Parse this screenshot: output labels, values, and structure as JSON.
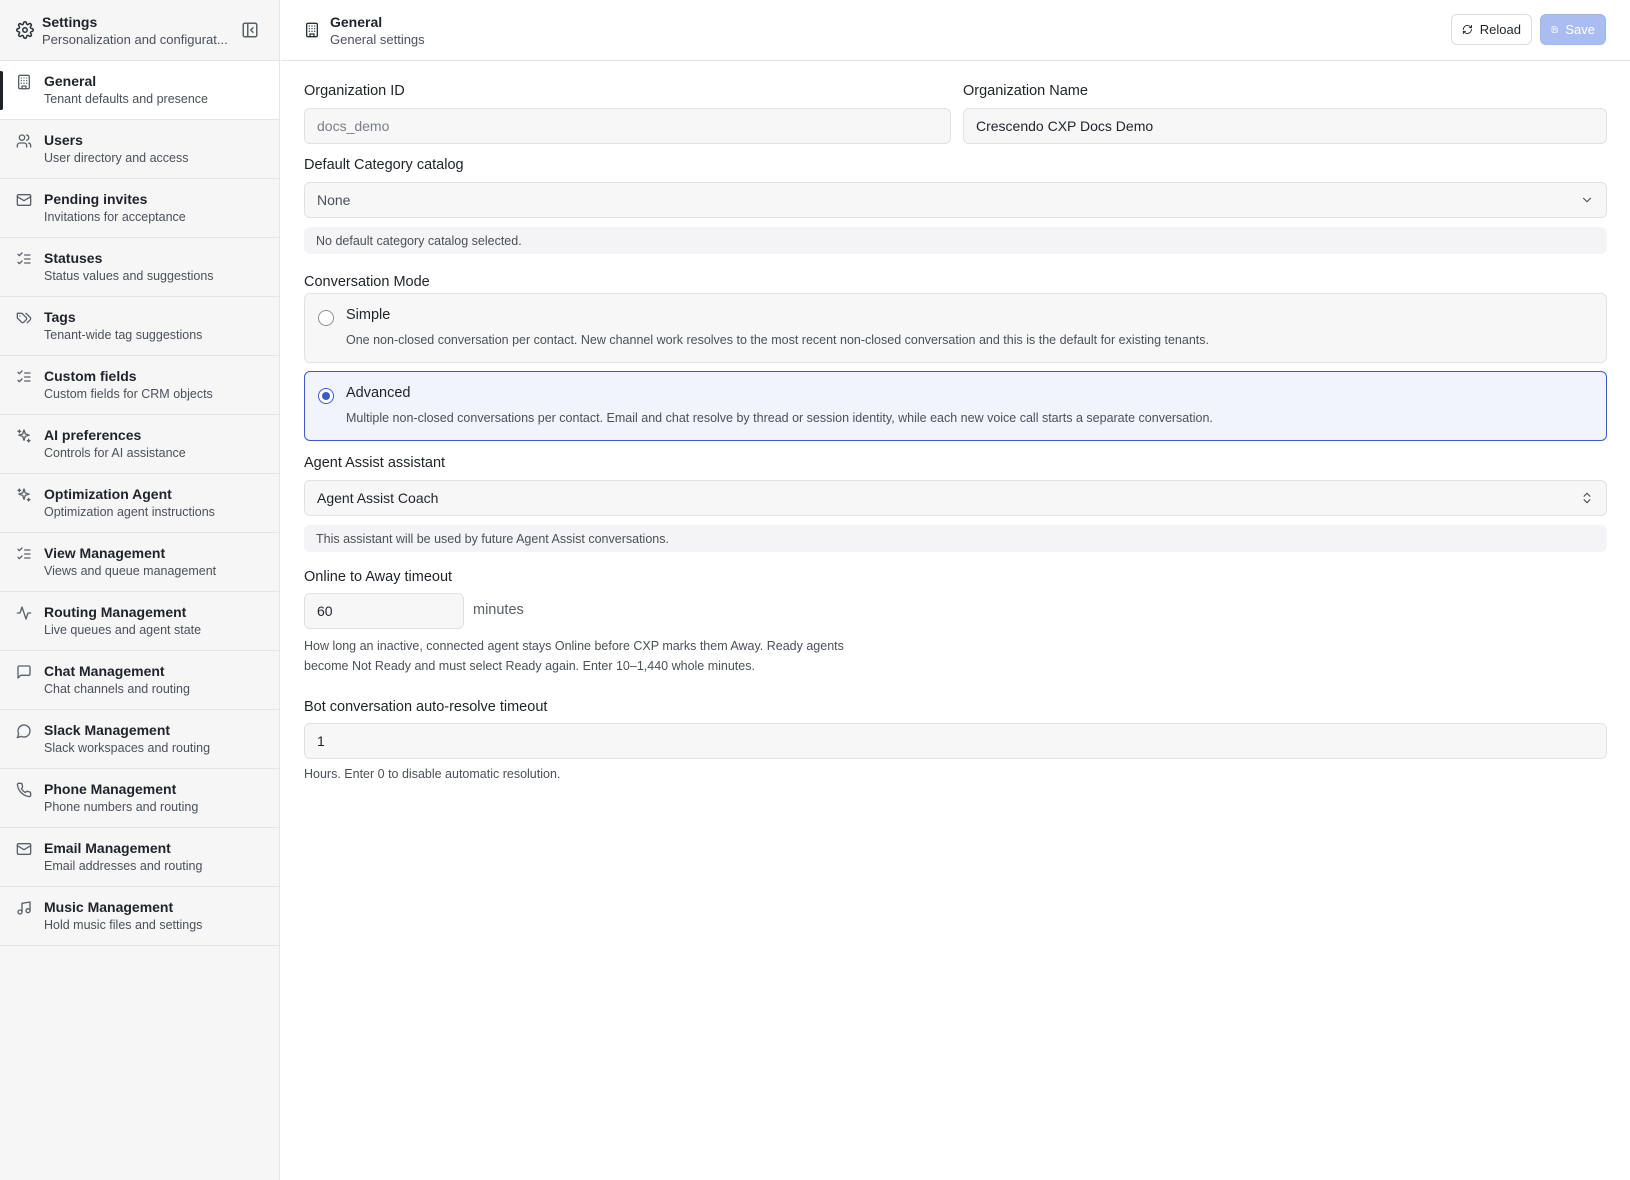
{
  "sidebar": {
    "title": "Settings",
    "subtitle": "Personalization and configurat...",
    "items": [
      {
        "label": "General",
        "desc": "Tenant defaults and presence",
        "icon": "building-icon"
      },
      {
        "label": "Users",
        "desc": "User directory and access",
        "icon": "users-icon"
      },
      {
        "label": "Pending invites",
        "desc": "Invitations for acceptance",
        "icon": "mail-icon"
      },
      {
        "label": "Statuses",
        "desc": "Status values and suggestions",
        "icon": "list-checks-icon"
      },
      {
        "label": "Tags",
        "desc": "Tenant-wide tag suggestions",
        "icon": "tags-icon"
      },
      {
        "label": "Custom fields",
        "desc": "Custom fields for CRM objects",
        "icon": "list-checks-icon"
      },
      {
        "label": "AI preferences",
        "desc": "Controls for AI assistance",
        "icon": "sparkles-icon"
      },
      {
        "label": "Optimization Agent",
        "desc": "Optimization agent instructions",
        "icon": "sparkles-icon"
      },
      {
        "label": "View Management",
        "desc": "Views and queue management",
        "icon": "list-checks-icon"
      },
      {
        "label": "Routing Management",
        "desc": "Live queues and agent state",
        "icon": "activity-icon"
      },
      {
        "label": "Chat Management",
        "desc": "Chat channels and routing",
        "icon": "message-square-icon"
      },
      {
        "label": "Slack Management",
        "desc": "Slack workspaces and routing",
        "icon": "message-circle-icon"
      },
      {
        "label": "Phone Management",
        "desc": "Phone numbers and routing",
        "icon": "phone-icon"
      },
      {
        "label": "Email Management",
        "desc": "Email addresses and routing",
        "icon": "mail-icon"
      },
      {
        "label": "Music Management",
        "desc": "Hold music files and settings",
        "icon": "music-icon"
      }
    ],
    "active_index": 0
  },
  "header": {
    "title": "General",
    "subtitle": "General settings",
    "reload_label": "Reload",
    "save_label": "Save"
  },
  "form": {
    "org_id_label": "Organization ID",
    "org_id_value": "docs_demo",
    "org_name_label": "Organization Name",
    "org_name_value": "Crescendo CXP Docs Demo",
    "category_label": "Default Category catalog",
    "category_value": "None",
    "category_help": "No default category catalog selected.",
    "mode_label": "Conversation Mode",
    "modes": [
      {
        "title": "Simple",
        "desc": "One non-closed conversation per contact. New channel work resolves to the most recent non-closed conversation and this is the default for existing tenants.",
        "selected": false
      },
      {
        "title": "Advanced",
        "desc": "Multiple non-closed conversations per contact. Email and chat resolve by thread or session identity, while each new voice call starts a separate conversation.",
        "selected": true
      }
    ],
    "assist_label": "Agent Assist assistant",
    "assist_value": "Agent Assist Coach",
    "assist_help": "This assistant will be used by future Agent Assist conversations.",
    "away_label": "Online to Away timeout",
    "away_value": "60",
    "away_suffix": "minutes",
    "away_help_line1": "How long an inactive, connected agent stays Online before CXP marks them Away. Ready agents",
    "away_help_line2": "become Not Ready and must select Ready again. Enter 10–1,440 whole minutes.",
    "bot_label": "Bot conversation auto-resolve timeout",
    "bot_value": "1",
    "bot_help": "Hours. Enter 0 to disable automatic resolution."
  },
  "colors": {
    "accent": "#3b5cc7",
    "save_disabled": "#a9bdf0"
  }
}
